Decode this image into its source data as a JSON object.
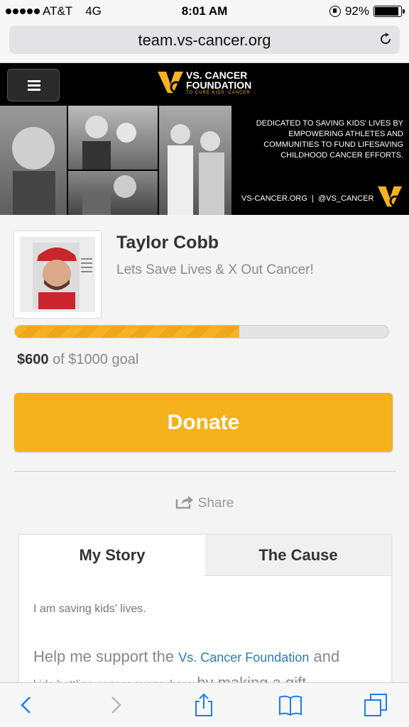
{
  "status_bar": {
    "carrier": "AT&T",
    "network": "4G",
    "time": "8:01 AM",
    "battery": "92%"
  },
  "browser": {
    "url": "team.vs-cancer.org"
  },
  "banner": {
    "logo_line1": "VS. CANCER",
    "logo_line2": "FOUNDATION",
    "logo_sub": "TO CURE KIDS' CANCER",
    "tagline_lines": [
      "DEDICATED TO SAVING KIDS' LIVES BY",
      "EMPOWERING ATHLETES AND",
      "COMMUNITIES TO FUND LIFESAVING",
      "CHILDHOOD CANCER EFFORTS."
    ],
    "links": "VS-CANCER.ORG  |  @VS_CANCER"
  },
  "profile": {
    "name": "Taylor Cobb",
    "tagline": "Lets Save Lives & X Out Cancer!"
  },
  "fundraising": {
    "raised": "$600",
    "goal_text": "of $1000 goal",
    "progress_fraction": 0.6
  },
  "actions": {
    "donate_label": "Donate",
    "share_label": "Share"
  },
  "tabs": [
    {
      "label": "My Story",
      "active": true
    },
    {
      "label": "The Cause",
      "active": false
    }
  ],
  "story": {
    "line1": "I am saving kids' lives.",
    "para_start": "Help me support the",
    "para_link": "Vs. Cancer Foundation",
    "para_mid": "and",
    "para_small": "kids battling cancer everywhere",
    "para_end": "by making a gift."
  },
  "colors": {
    "accent": "#f6b21c",
    "link": "#2a7abf",
    "ios_blue": "#1a7cf5"
  },
  "icons": [
    "hamburger-icon",
    "reload-icon",
    "share-icon",
    "back-icon",
    "forward-icon",
    "bookmarks-icon",
    "tabs-icon"
  ]
}
